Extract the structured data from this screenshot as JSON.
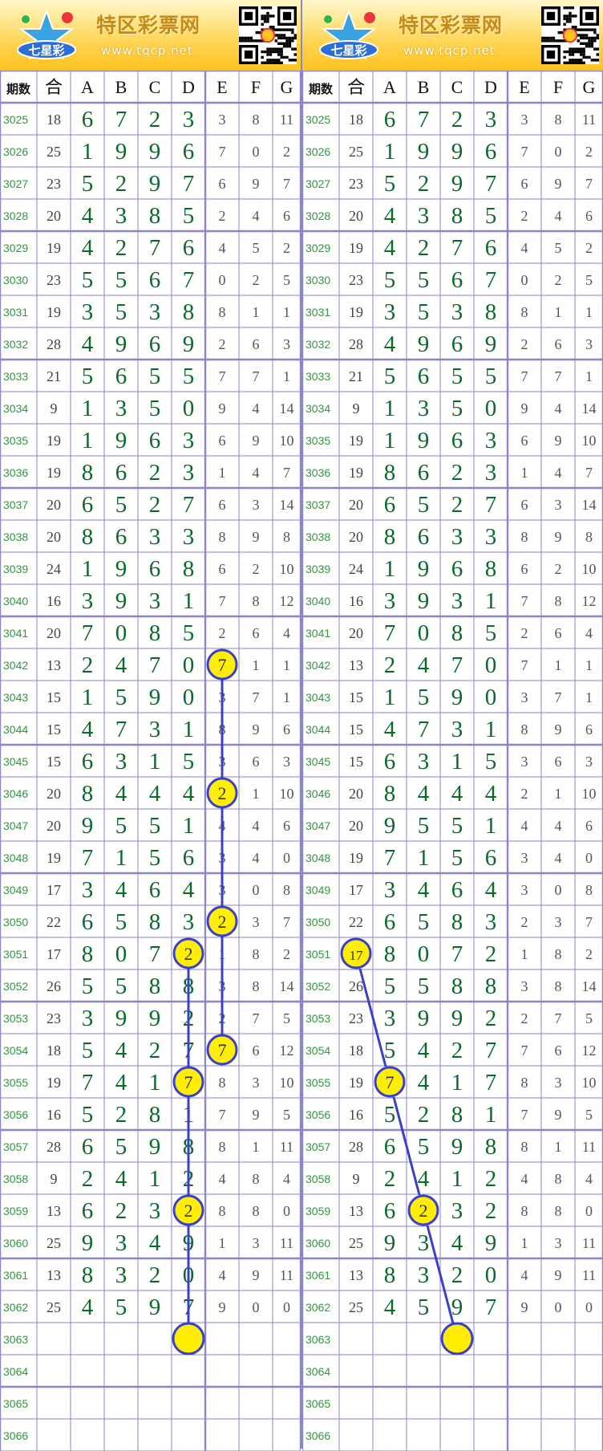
{
  "site": {
    "name": "特区彩票网",
    "url": "www.tqcp.net",
    "logo_text": "七星彩"
  },
  "headers": [
    "期数",
    "合",
    "A",
    "B",
    "C",
    "D",
    "E",
    "F",
    "G"
  ],
  "rows": [
    {
      "p": "3025",
      "s": "18",
      "n": [
        6,
        7,
        2,
        3,
        3,
        8,
        11
      ]
    },
    {
      "p": "3026",
      "s": "25",
      "n": [
        1,
        9,
        9,
        6,
        7,
        0,
        2
      ]
    },
    {
      "p": "3027",
      "s": "23",
      "n": [
        5,
        2,
        9,
        7,
        6,
        9,
        7
      ]
    },
    {
      "p": "3028",
      "s": "20",
      "n": [
        4,
        3,
        8,
        5,
        2,
        4,
        6
      ]
    },
    {
      "p": "3029",
      "s": "19",
      "n": [
        4,
        2,
        7,
        6,
        4,
        5,
        2
      ]
    },
    {
      "p": "3030",
      "s": "23",
      "n": [
        5,
        5,
        6,
        7,
        0,
        2,
        5
      ]
    },
    {
      "p": "3031",
      "s": "19",
      "n": [
        3,
        5,
        3,
        8,
        8,
        1,
        1
      ]
    },
    {
      "p": "3032",
      "s": "28",
      "n": [
        4,
        9,
        6,
        9,
        2,
        6,
        3
      ]
    },
    {
      "p": "3033",
      "s": "21",
      "n": [
        5,
        6,
        5,
        5,
        7,
        7,
        1
      ]
    },
    {
      "p": "3034",
      "s": "9",
      "n": [
        1,
        3,
        5,
        0,
        9,
        4,
        14
      ]
    },
    {
      "p": "3035",
      "s": "19",
      "n": [
        1,
        9,
        6,
        3,
        6,
        9,
        10
      ]
    },
    {
      "p": "3036",
      "s": "19",
      "n": [
        8,
        6,
        2,
        3,
        1,
        4,
        7
      ]
    },
    {
      "p": "3037",
      "s": "20",
      "n": [
        6,
        5,
        2,
        7,
        6,
        3,
        14
      ]
    },
    {
      "p": "3038",
      "s": "20",
      "n": [
        8,
        6,
        3,
        3,
        8,
        9,
        8
      ]
    },
    {
      "p": "3039",
      "s": "24",
      "n": [
        1,
        9,
        6,
        8,
        6,
        2,
        10
      ]
    },
    {
      "p": "3040",
      "s": "16",
      "n": [
        3,
        9,
        3,
        1,
        7,
        8,
        12
      ]
    },
    {
      "p": "3041",
      "s": "20",
      "n": [
        7,
        0,
        8,
        5,
        2,
        6,
        4
      ]
    },
    {
      "p": "3042",
      "s": "13",
      "n": [
        2,
        4,
        7,
        0,
        7,
        1,
        1
      ]
    },
    {
      "p": "3043",
      "s": "15",
      "n": [
        1,
        5,
        9,
        0,
        3,
        7,
        1
      ]
    },
    {
      "p": "3044",
      "s": "15",
      "n": [
        4,
        7,
        3,
        1,
        8,
        9,
        6
      ]
    },
    {
      "p": "3045",
      "s": "15",
      "n": [
        6,
        3,
        1,
        5,
        3,
        6,
        3
      ]
    },
    {
      "p": "3046",
      "s": "20",
      "n": [
        8,
        4,
        4,
        4,
        2,
        1,
        10
      ]
    },
    {
      "p": "3047",
      "s": "20",
      "n": [
        9,
        5,
        5,
        1,
        4,
        4,
        6
      ]
    },
    {
      "p": "3048",
      "s": "19",
      "n": [
        7,
        1,
        5,
        6,
        3,
        4,
        0
      ]
    },
    {
      "p": "3049",
      "s": "17",
      "n": [
        3,
        4,
        6,
        4,
        3,
        0,
        8
      ]
    },
    {
      "p": "3050",
      "s": "22",
      "n": [
        6,
        5,
        8,
        3,
        2,
        3,
        7
      ]
    },
    {
      "p": "3051",
      "s": "17",
      "n": [
        8,
        0,
        7,
        2,
        1,
        8,
        2
      ]
    },
    {
      "p": "3052",
      "s": "26",
      "n": [
        5,
        5,
        8,
        8,
        3,
        8,
        14
      ]
    },
    {
      "p": "3053",
      "s": "23",
      "n": [
        3,
        9,
        9,
        2,
        2,
        7,
        5
      ]
    },
    {
      "p": "3054",
      "s": "18",
      "n": [
        5,
        4,
        2,
        7,
        7,
        6,
        12
      ]
    },
    {
      "p": "3055",
      "s": "19",
      "n": [
        7,
        4,
        1,
        7,
        8,
        3,
        10
      ]
    },
    {
      "p": "3056",
      "s": "16",
      "n": [
        5,
        2,
        8,
        1,
        7,
        9,
        5
      ]
    },
    {
      "p": "3057",
      "s": "28",
      "n": [
        6,
        5,
        9,
        8,
        8,
        1,
        11
      ]
    },
    {
      "p": "3058",
      "s": "9",
      "n": [
        2,
        4,
        1,
        2,
        4,
        8,
        4
      ]
    },
    {
      "p": "3059",
      "s": "13",
      "n": [
        6,
        2,
        3,
        2,
        8,
        8,
        0
      ]
    },
    {
      "p": "3060",
      "s": "25",
      "n": [
        9,
        3,
        4,
        9,
        1,
        3,
        11
      ]
    },
    {
      "p": "3061",
      "s": "13",
      "n": [
        8,
        3,
        2,
        0,
        4,
        9,
        11
      ]
    },
    {
      "p": "3062",
      "s": "25",
      "n": [
        4,
        5,
        9,
        7,
        9,
        0,
        0
      ]
    },
    {
      "p": "3063",
      "s": "",
      "n": []
    },
    {
      "p": "3064",
      "s": "",
      "n": []
    },
    {
      "p": "3065",
      "s": "",
      "n": []
    },
    {
      "p": "3066",
      "s": "",
      "n": []
    }
  ],
  "panels": [
    {
      "id": "left",
      "marks": [
        {
          "p": "3042",
          "col": "E",
          "v": "7"
        },
        {
          "p": "3046",
          "col": "E",
          "v": "2"
        },
        {
          "p": "3050",
          "col": "E",
          "v": "2"
        },
        {
          "p": "3054",
          "col": "E",
          "v": "7"
        },
        {
          "p": "3051",
          "col": "D",
          "v": "2"
        },
        {
          "p": "3055",
          "col": "D",
          "v": "7"
        },
        {
          "p": "3059",
          "col": "D",
          "v": "2"
        },
        {
          "p": "3063",
          "col": "D",
          "v": ""
        }
      ],
      "lines": [
        [
          {
            "p": "3042",
            "col": "E"
          },
          {
            "p": "3054",
            "col": "E"
          }
        ],
        [
          {
            "p": "3051",
            "col": "D"
          },
          {
            "p": "3063",
            "col": "D"
          }
        ]
      ]
    },
    {
      "id": "right",
      "marks": [
        {
          "p": "3051",
          "col": "合",
          "v": "17"
        },
        {
          "p": "3055",
          "col": "A",
          "v": "7"
        },
        {
          "p": "3059",
          "col": "B",
          "v": "2"
        },
        {
          "p": "3063",
          "col": "C",
          "v": ""
        }
      ],
      "lines": [
        [
          {
            "p": "3051",
            "col": "合"
          },
          {
            "p": "3063",
            "col": "C"
          }
        ]
      ]
    }
  ],
  "colors": {
    "grid": "#8a86c8",
    "period": "#2a9a3a",
    "digit": "#0a6a2a",
    "mark": "#ffee00",
    "mark_border": "#3a40c8",
    "line": "#3a40c8",
    "banner": "#ffc21e"
  }
}
